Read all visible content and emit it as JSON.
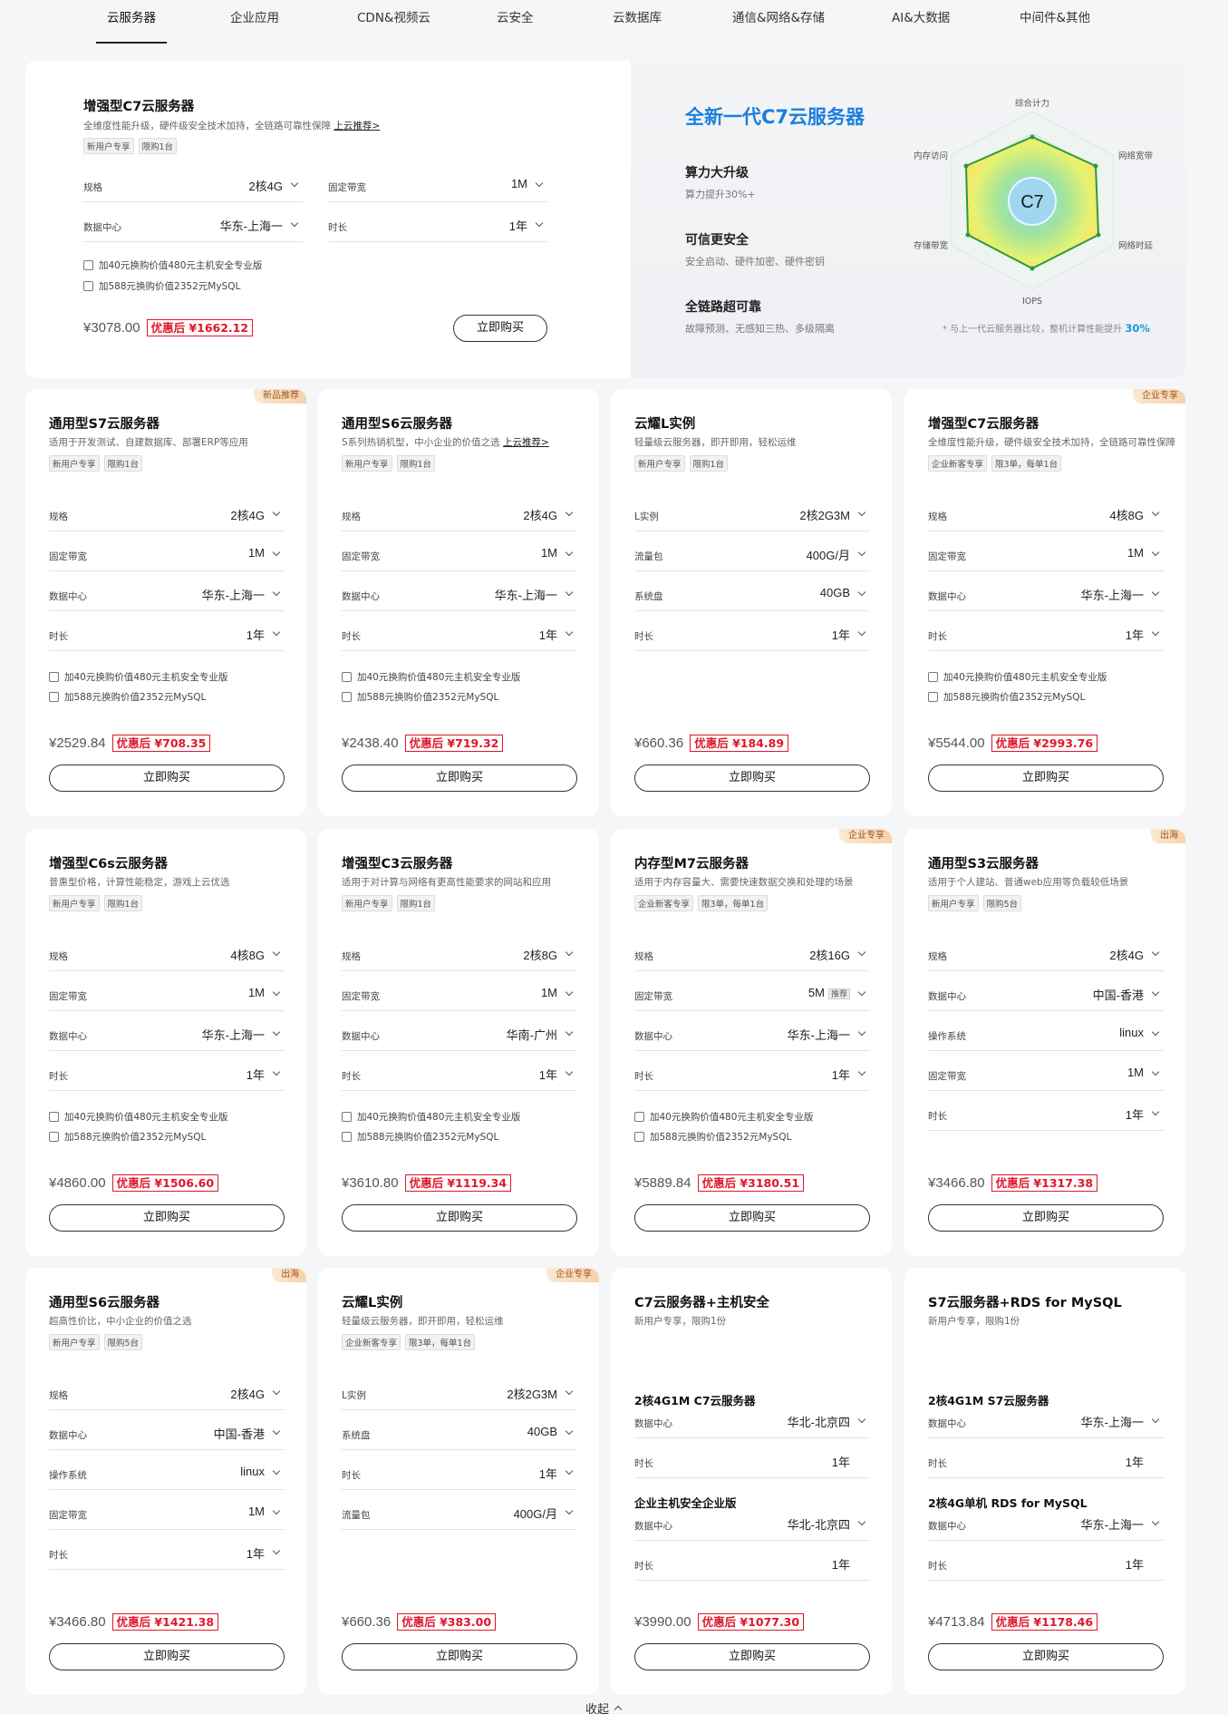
{
  "tabs": [
    "云服务器",
    "企业应用",
    "CDN&视频云",
    "云安全",
    "云数据库",
    "通信&网络&存储",
    "AI&大数据",
    "中间件&其他"
  ],
  "hero": {
    "title": "增强型C7云服务器",
    "subtitle": "全维度性能升级，硬件级安全技术加持，全链路可靠性保障",
    "subtitle_link": "上云推荐>",
    "tags": [
      "新用户专享",
      "限购1台"
    ],
    "rows": [
      {
        "label": "规格",
        "value": "2核4G"
      },
      {
        "label": "固定带宽",
        "value": "1M"
      },
      {
        "label": "数据中心",
        "value": "华东-上海一"
      },
      {
        "label": "时长",
        "value": "1年"
      }
    ],
    "checks": [
      "加40元换购价值480元主机安全专业版",
      "加588元换购价值2352元MySQL"
    ],
    "price": "¥3078.00",
    "discount": "优惠后 ¥1662.12",
    "button": "立即购买",
    "promo": {
      "headline": "全新一代C7云服务器",
      "features": [
        {
          "title": "算力大升级",
          "desc": "算力提升30%+"
        },
        {
          "title": "可信更安全",
          "desc": "安全启动、硬件加密、硬件密钥"
        },
        {
          "title": "全链路超可靠",
          "desc": "故障预测、无感知三热、多级隔离"
        }
      ],
      "radar_center": "C7",
      "radar_labels": [
        "综合计力",
        "网络宽带",
        "网络时延",
        "IOPS",
        "存储带宽",
        "内存访问"
      ],
      "footnote": "* 与上一代云服务器比较，整机计算性能提升",
      "footnote_value": "30%"
    }
  },
  "products": [
    {
      "title": "通用型S7云服务器",
      "subtitle": "适用于开发测试、自建数据库、部署ERP等应用",
      "tags": [
        "新用户专享",
        "限购1台"
      ],
      "badge": "新品推荐",
      "rows": [
        {
          "label": "规格",
          "value": "2核4G"
        },
        {
          "label": "固定带宽",
          "value": "1M"
        },
        {
          "label": "数据中心",
          "value": "华东-上海一"
        },
        {
          "label": "时长",
          "value": "1年"
        }
      ],
      "checks": [
        "加40元换购价值480元主机安全专业版",
        "加588元换购价值2352元MySQL"
      ],
      "price": "¥2529.84",
      "discount": "优惠后 ¥708.35",
      "button": "立即购买"
    },
    {
      "title": "通用型S6云服务器",
      "subtitle": "S系列热销机型，中小企业的价值之选",
      "link": "上云推荐>",
      "tags": [
        "新用户专享",
        "限购1台"
      ],
      "rows": [
        {
          "label": "规格",
          "value": "2核4G"
        },
        {
          "label": "固定带宽",
          "value": "1M"
        },
        {
          "label": "数据中心",
          "value": "华东-上海一"
        },
        {
          "label": "时长",
          "value": "1年"
        }
      ],
      "checks": [
        "加40元换购价值480元主机安全专业版",
        "加588元换购价值2352元MySQL"
      ],
      "price": "¥2438.40",
      "discount": "优惠后 ¥719.32",
      "button": "立即购买"
    },
    {
      "title": "云耀L实例",
      "subtitle": "轻量级云服务器，即开即用，轻松运维",
      "tags": [
        "新用户专享",
        "限购1台"
      ],
      "rows": [
        {
          "label": "L实例",
          "value": "2核2G3M"
        },
        {
          "label": "流量包",
          "value": "400G/月"
        },
        {
          "label": "系统盘",
          "value": "40GB"
        },
        {
          "label": "时长",
          "value": "1年"
        }
      ],
      "checks": [],
      "price": "¥660.36",
      "discount": "优惠后 ¥184.89",
      "button": "立即购买"
    },
    {
      "title": "增强型C7云服务器",
      "subtitle": "全维度性能升级，硬件级安全技术加持，全链路可靠性保障",
      "tags": [
        "企业新客专享",
        "限3单，每单1台"
      ],
      "badge": "企业专享",
      "rows": [
        {
          "label": "规格",
          "value": "4核8G"
        },
        {
          "label": "固定带宽",
          "value": "1M"
        },
        {
          "label": "数据中心",
          "value": "华东-上海一"
        },
        {
          "label": "时长",
          "value": "1年"
        }
      ],
      "checks": [
        "加40元换购价值480元主机安全专业版",
        "加588元换购价值2352元MySQL"
      ],
      "price": "¥5544.00",
      "discount": "优惠后 ¥2993.76",
      "button": "立即购买"
    },
    {
      "title": "增强型C6s云服务器",
      "subtitle": "普惠型价格，计算性能稳定，游戏上云优选",
      "tags": [
        "新用户专享",
        "限购1台"
      ],
      "rows": [
        {
          "label": "规格",
          "value": "4核8G"
        },
        {
          "label": "固定带宽",
          "value": "1M"
        },
        {
          "label": "数据中心",
          "value": "华东-上海一"
        },
        {
          "label": "时长",
          "value": "1年"
        }
      ],
      "checks": [
        "加40元换购价值480元主机安全专业版",
        "加588元换购价值2352元MySQL"
      ],
      "price": "¥4860.00",
      "discount": "优惠后 ¥1506.60",
      "button": "立即购买"
    },
    {
      "title": "增强型C3云服务器",
      "subtitle": "适用于对计算与网络有更高性能要求的网站和应用",
      "tags": [
        "新用户专享",
        "限购1台"
      ],
      "rows": [
        {
          "label": "规格",
          "value": "2核8G"
        },
        {
          "label": "固定带宽",
          "value": "1M"
        },
        {
          "label": "数据中心",
          "value": "华南-广州"
        },
        {
          "label": "时长",
          "value": "1年"
        }
      ],
      "checks": [
        "加40元换购价值480元主机安全专业版",
        "加588元换购价值2352元MySQL"
      ],
      "price": "¥3610.80",
      "discount": "优惠后 ¥1119.34",
      "button": "立即购买"
    },
    {
      "title": "内存型M7云服务器",
      "subtitle": "适用于内存容量大、需要快速数据交换和处理的场景",
      "tags": [
        "企业新客专享",
        "限3单，每单1台"
      ],
      "badge": "企业专享",
      "rows": [
        {
          "label": "规格",
          "value": "2核16G"
        },
        {
          "label": "固定带宽",
          "value": "5M",
          "extra": "推荐"
        },
        {
          "label": "数据中心",
          "value": "华东-上海一"
        },
        {
          "label": "时长",
          "value": "1年"
        }
      ],
      "checks": [
        "加40元换购价值480元主机安全专业版",
        "加588元换购价值2352元MySQL"
      ],
      "price": "¥5889.84",
      "discount": "优惠后 ¥3180.51",
      "button": "立即购买"
    },
    {
      "title": "通用型S3云服务器",
      "subtitle": "适用于个人建站、普通web应用等负载较低场景",
      "tags": [
        "新用户专享",
        "限购5台"
      ],
      "badge": "出海",
      "rows": [
        {
          "label": "规格",
          "value": "2核4G"
        },
        {
          "label": "数据中心",
          "value": "中国-香港"
        },
        {
          "label": "操作系统",
          "value": "linux"
        },
        {
          "label": "固定带宽",
          "value": "1M"
        },
        {
          "label": "时长",
          "value": "1年"
        }
      ],
      "checks": [],
      "price": "¥3466.80",
      "discount": "优惠后 ¥1317.38",
      "button": "立即购买"
    },
    {
      "title": "通用型S6云服务器",
      "subtitle": "超高性价比，中小企业的价值之选",
      "tags": [
        "新用户专享",
        "限购5台"
      ],
      "badge": "出海",
      "rows": [
        {
          "label": "规格",
          "value": "2核4G"
        },
        {
          "label": "数据中心",
          "value": "中国-香港"
        },
        {
          "label": "操作系统",
          "value": "linux"
        },
        {
          "label": "固定带宽",
          "value": "1M"
        },
        {
          "label": "时长",
          "value": "1年"
        }
      ],
      "checks": [],
      "price": "¥3466.80",
      "discount": "优惠后 ¥1421.38",
      "button": "立即购买"
    },
    {
      "title": "云耀L实例",
      "subtitle": "轻量级云服务器，即开即用，轻松运维",
      "tags": [
        "企业新客专享",
        "限3单，每单1台"
      ],
      "badge": "企业专享",
      "rows": [
        {
          "label": "L实例",
          "value": "2核2G3M"
        },
        {
          "label": "系统盘",
          "value": "40GB"
        },
        {
          "label": "时长",
          "value": "1年"
        },
        {
          "label": "流量包",
          "value": "400G/月"
        }
      ],
      "checks": [],
      "price": "¥660.36",
      "discount": "优惠后 ¥383.00",
      "button": "立即购买"
    },
    {
      "title": "C7云服务器+主机安全",
      "subtitle": "新用户专享，限购1份",
      "sections": [
        {
          "title": "2核4G1M C7云服务器",
          "rows": [
            {
              "label": "数据中心",
              "value": "华北-北京四"
            },
            {
              "label": "时长",
              "value": "1年"
            }
          ]
        },
        {
          "title": "企业主机安全企业版",
          "rows": [
            {
              "label": "数据中心",
              "value": "华北-北京四"
            },
            {
              "label": "时长",
              "value": "1年"
            }
          ]
        }
      ],
      "price": "¥3990.00",
      "discount": "优惠后 ¥1077.30",
      "button": "立即购买"
    },
    {
      "title": "S7云服务器+RDS for MySQL",
      "subtitle": "新用户专享，限购1份",
      "sections": [
        {
          "title": "2核4G1M S7云服务器",
          "rows": [
            {
              "label": "数据中心",
              "value": "华东-上海一"
            },
            {
              "label": "时长",
              "value": "1年"
            }
          ]
        },
        {
          "title": "2核4G单机 RDS for MySQL",
          "rows": [
            {
              "label": "数据中心",
              "value": "华东-上海一"
            },
            {
              "label": "时长",
              "value": "1年"
            }
          ]
        }
      ],
      "price": "¥4713.84",
      "discount": "优惠后 ¥1178.46",
      "button": "立即购买"
    }
  ],
  "collapse": "收起"
}
